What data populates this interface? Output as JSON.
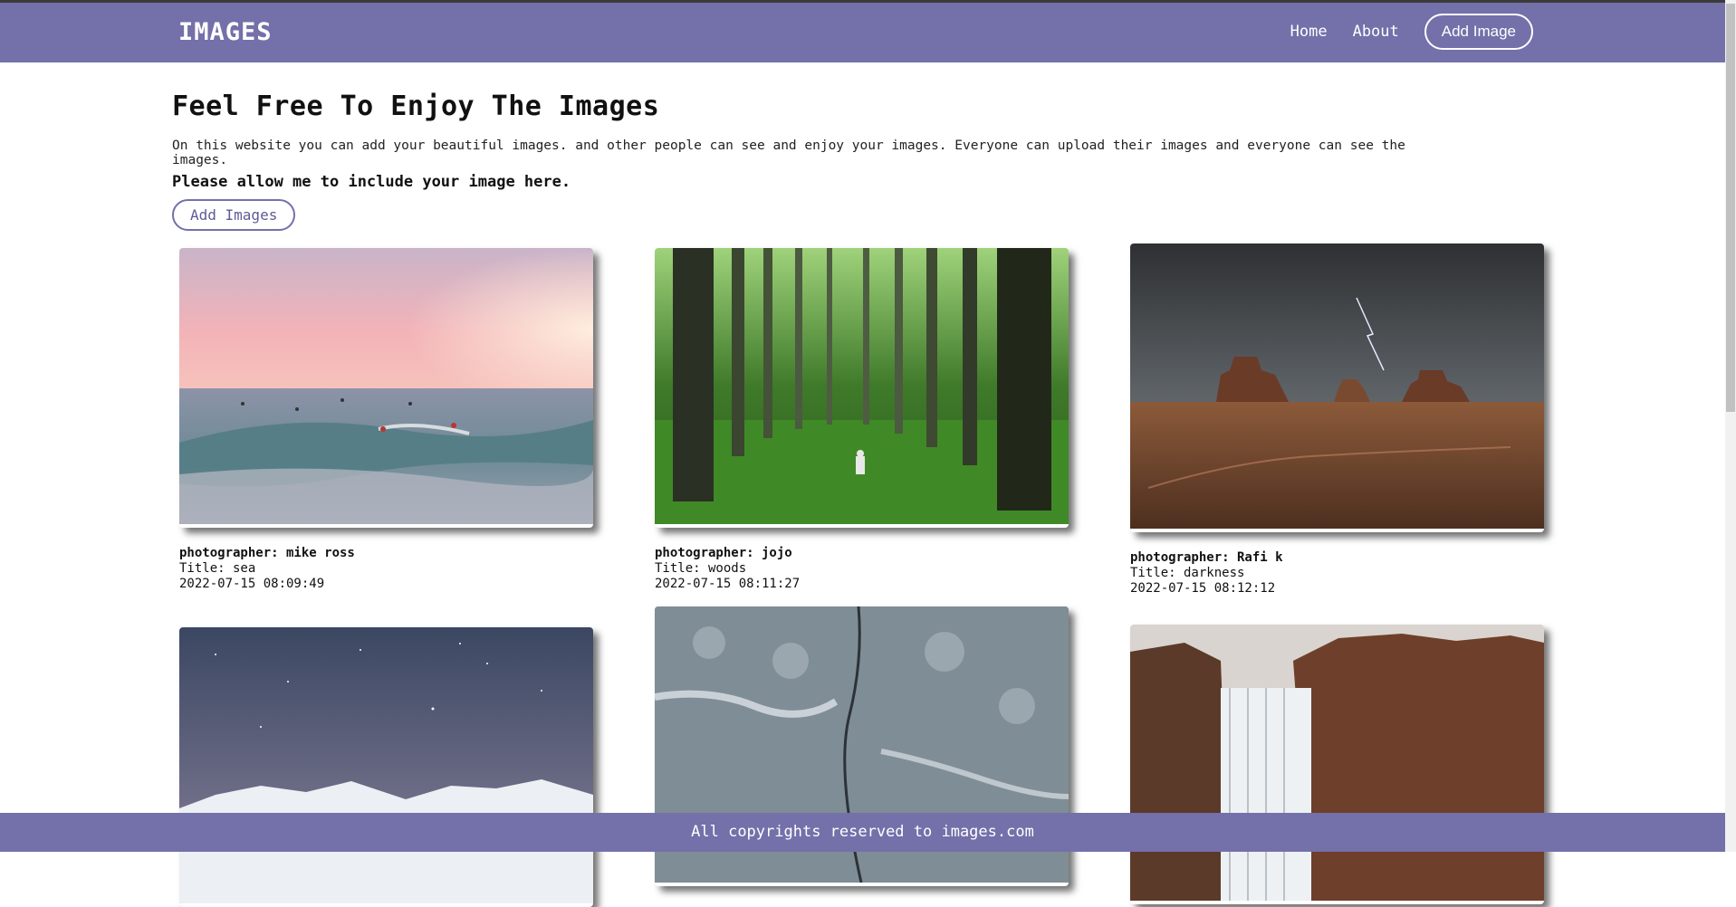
{
  "navbar": {
    "brand": "IMAGES",
    "links": [
      "Home",
      "About"
    ],
    "add_button": "Add Image"
  },
  "intro": {
    "title": "Feel Free To Enjoy The Images",
    "description": "On this website you can add your beautiful images. and other people can see and enjoy your images. Everyone can upload their images and everyone can see the images.",
    "note": "Please allow me to include your image here.",
    "button": "Add Images"
  },
  "cards": [
    {
      "photographer": "photographer: mike ross",
      "title": "Title: sea",
      "date": "2022-07-15 08:09:49"
    },
    {
      "photographer": "photographer: jojo",
      "title": "Title: woods",
      "date": "2022-07-15 08:11:27"
    },
    {
      "photographer": "photographer: Rafi k",
      "title": "Title: darkness",
      "date": "2022-07-15 08:12:12"
    }
  ],
  "footer": {
    "text": "All copyrights reserved to images.com"
  },
  "colors": {
    "accent": "#7370aa"
  }
}
